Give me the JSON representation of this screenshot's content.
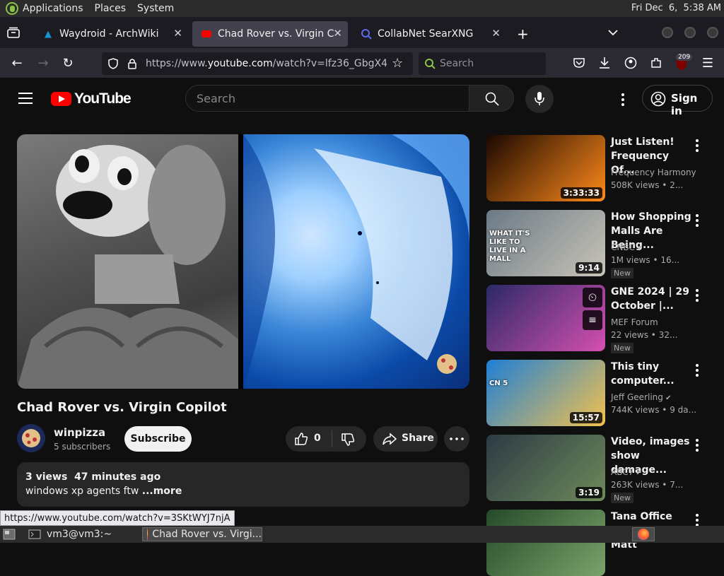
{
  "panel": {
    "menus": [
      "Applications",
      "Places",
      "System"
    ],
    "clock": "Fri Dec  6,  5:38 AM"
  },
  "tabs": [
    {
      "title": "Waydroid - ArchWiki",
      "favicon": "archwiki-icon"
    },
    {
      "title": "Chad Rover vs. Virgin Copilot",
      "favicon": "youtube-icon",
      "active": true
    },
    {
      "title": "CollabNet SearXNG",
      "favicon": "searxng-icon"
    }
  ],
  "navbar": {
    "url_prefix": "https://www.",
    "url_host": "youtube.com",
    "url_path": "/watch?v=lfz36_GbgX4",
    "search_placeholder": "Search",
    "extension_badge": "209"
  },
  "youtube": {
    "logo_text": "YouTube",
    "search_placeholder": "Search",
    "signin_label": "Sign in",
    "video": {
      "title": "Chad Rover vs. Virgin Copilot",
      "channel": "winpizza",
      "subscribers": "5 subscribers",
      "subscribe_label": "Subscribe",
      "likes": "0",
      "share_label": "Share",
      "views": "3 views",
      "age": "47 minutes ago",
      "description": "windows xp agents ftw",
      "more_label": "...more"
    },
    "recommendations": [
      {
        "title_l1": "Just Listen!",
        "title_l2": "Frequency Of...",
        "channel": "Frequency Harmony",
        "verified": false,
        "views": "508K views",
        "age": "2...",
        "duration": "3:33:33",
        "new": false,
        "colors": [
          "#1a0800",
          "#ff8a1a"
        ]
      },
      {
        "title_l1": "How Shopping",
        "title_l2": "Malls Are Being...",
        "channel": "CNBC",
        "verified": true,
        "views": "1M views",
        "age": "16...",
        "duration": "9:14",
        "new": true,
        "new_label": "New",
        "overlay": "WHAT IT'S LIKE TO LIVE IN A MALL",
        "colors": [
          "#6b7a86",
          "#c9c4b8"
        ]
      },
      {
        "title_l1": "GNE 2024 | 29",
        "title_l2": "October |...",
        "channel": "MEF Forum",
        "verified": false,
        "views": "22 views",
        "age": "32...",
        "duration": "",
        "new": true,
        "new_label": "New",
        "colors": [
          "#2a2a66",
          "#d64fb0"
        ]
      },
      {
        "title_l1": "This tiny",
        "title_l2": "computer...",
        "channel": "Jeff Geerling",
        "verified": true,
        "views": "744K views",
        "age": "9 da...",
        "duration": "15:57",
        "new": false,
        "overlay": "CN 5",
        "colors": [
          "#1e7fd6",
          "#f2c14e"
        ]
      },
      {
        "title_l1": "Video, images",
        "title_l2": "show damage...",
        "channel": "ABC7",
        "verified": true,
        "views": "263K views",
        "age": "7...",
        "duration": "3:19",
        "new": true,
        "new_label": "New",
        "colors": [
          "#2c3a44",
          "#6e8a5a"
        ]
      },
      {
        "title_l1": "Tana Office",
        "title_l2": "Hours with Matt",
        "channel": "",
        "verified": false,
        "views": "",
        "age": "",
        "duration": "",
        "new": false,
        "colors": [
          "#264a2a",
          "#7aa36a"
        ]
      }
    ]
  },
  "status_url": "https://www.youtube.com/watch?v=3SKtWYJ7njA",
  "taskbar": {
    "terminal": "vm3@vm3:~",
    "firefox": "Chad Rover vs. Virgi..."
  }
}
